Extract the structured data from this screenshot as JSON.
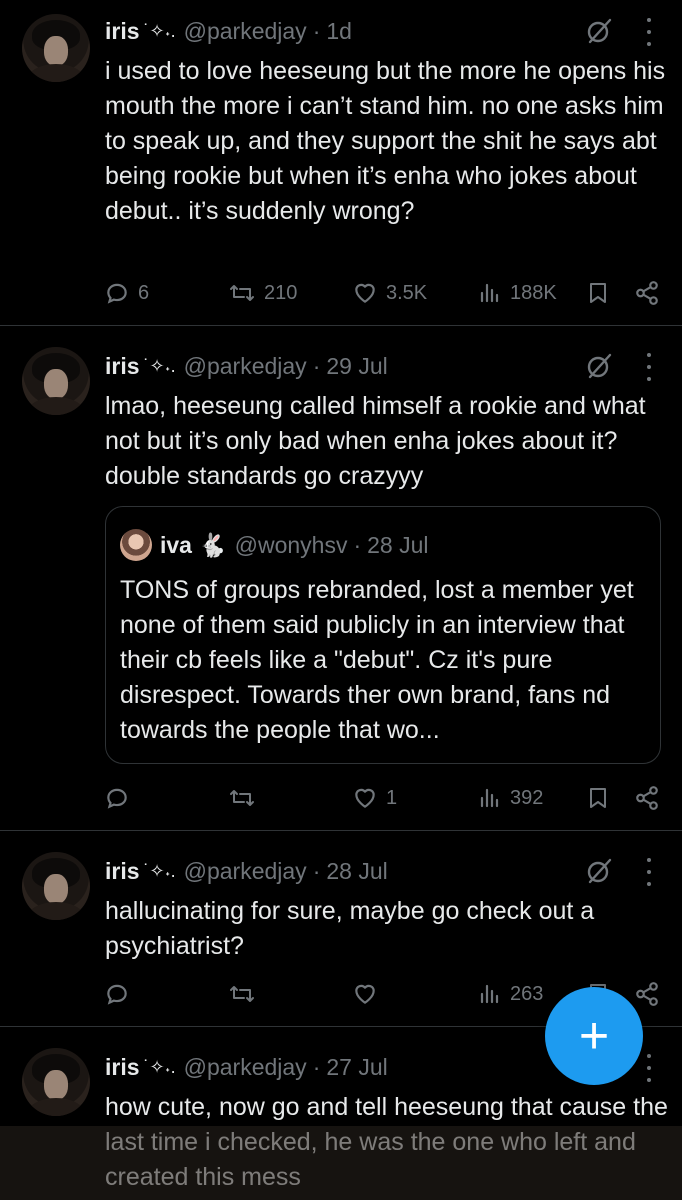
{
  "colors": {
    "background": "#000000",
    "text": "#e7e9ea",
    "muted": "#71767b",
    "divider": "#2f3336",
    "accent": "#1d9bf0"
  },
  "tweets": [
    {
      "name": "iris",
      "sparkle": "˙✧˖.",
      "handle": "@parkedjay",
      "time": "1d",
      "text": "i used to love heeseung but the more he opens his mouth the more i can’t stand him. no one asks him to speak up, and they support the shit he says abt being rookie but when it’s enha who jokes about debut.. it’s suddenly wrong?",
      "replies": "6",
      "reposts": "210",
      "likes": "3.5K",
      "views": "188K"
    },
    {
      "name": "iris",
      "sparkle": "˙✧˖.",
      "handle": "@parkedjay",
      "time": "29 Jul",
      "text": "lmao, heeseung called himself a rookie and what not but it’s only bad when enha jokes about it? double standards go crazyyy",
      "quote": {
        "name": "iva",
        "emoji": "🐇",
        "handle": "@wonyhsv",
        "time": "28 Jul",
        "text": "TONS of groups rebranded, lost a member yet none of them said publicly in an interview that their cb feels like a \"debut\". Cz it's pure disrespect. Towards ther own brand, fans nd towards the people that wo..."
      },
      "replies": "",
      "reposts": "",
      "likes": "1",
      "views": "392"
    },
    {
      "name": "iris",
      "sparkle": "˙✧˖.",
      "handle": "@parkedjay",
      "time": "28 Jul",
      "text": "hallucinating for sure, maybe go check out a psychiatrist?",
      "replies": "",
      "reposts": "",
      "likes": "",
      "views": "263"
    },
    {
      "name": "iris",
      "sparkle": "˙✧˖.",
      "handle": "@parkedjay",
      "time": "27 Jul",
      "text": "how cute, now go and tell heeseung that cause the last time i checked, he was the one who left and created this mess"
    }
  ],
  "fab": {
    "label": "+"
  },
  "icons": {
    "reply": "reply-icon",
    "repost": "repost-icon",
    "like": "heart-icon",
    "views": "views-icon",
    "bookmark": "bookmark-icon",
    "share": "share-icon",
    "grok": "grok-icon",
    "more": "more-icon"
  }
}
